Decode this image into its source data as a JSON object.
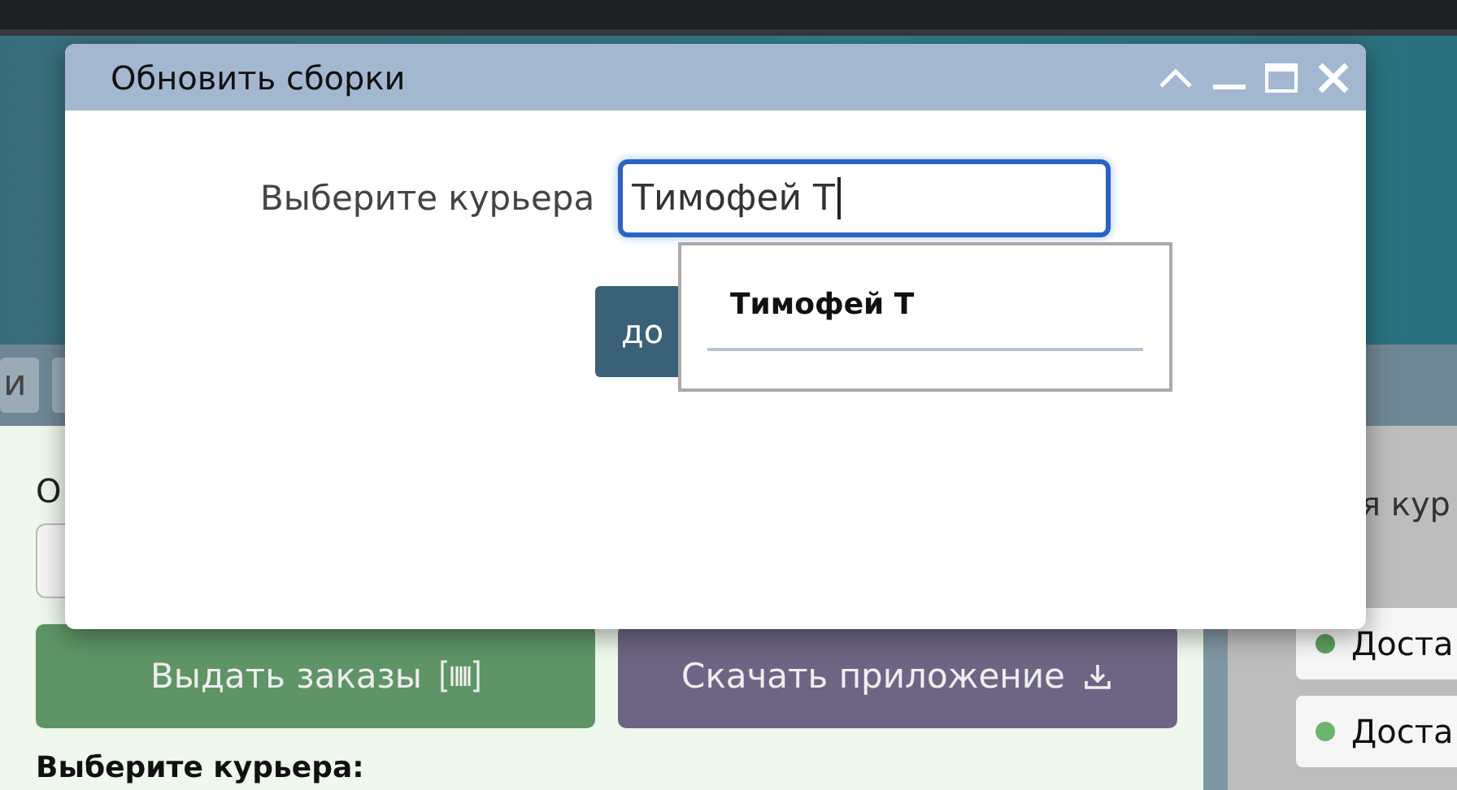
{
  "background": {
    "tabs": [
      {
        "label": "и",
        "selected": false
      },
      {
        "selected": false
      }
    ],
    "left_panel": {
      "label": "О",
      "buttons": [
        {
          "label": "Выдать заказы",
          "kind": "issue"
        },
        {
          "label": "Скачать приложение",
          "kind": "download"
        }
      ],
      "courier_label": "Выберите курьера:"
    },
    "right_panel": {
      "heading": "я кур",
      "items": [
        {
          "label": "Доста",
          "color": "#5e9e60"
        },
        {
          "label": "Доста",
          "color": "#6cb56e"
        }
      ]
    }
  },
  "dialog": {
    "title": "Обновить сборки",
    "label": "Выберите курьера",
    "input_value": "Тимофей Т",
    "button_label": "до",
    "suggestions": [
      {
        "label": "Тимофей Т"
      }
    ]
  }
}
